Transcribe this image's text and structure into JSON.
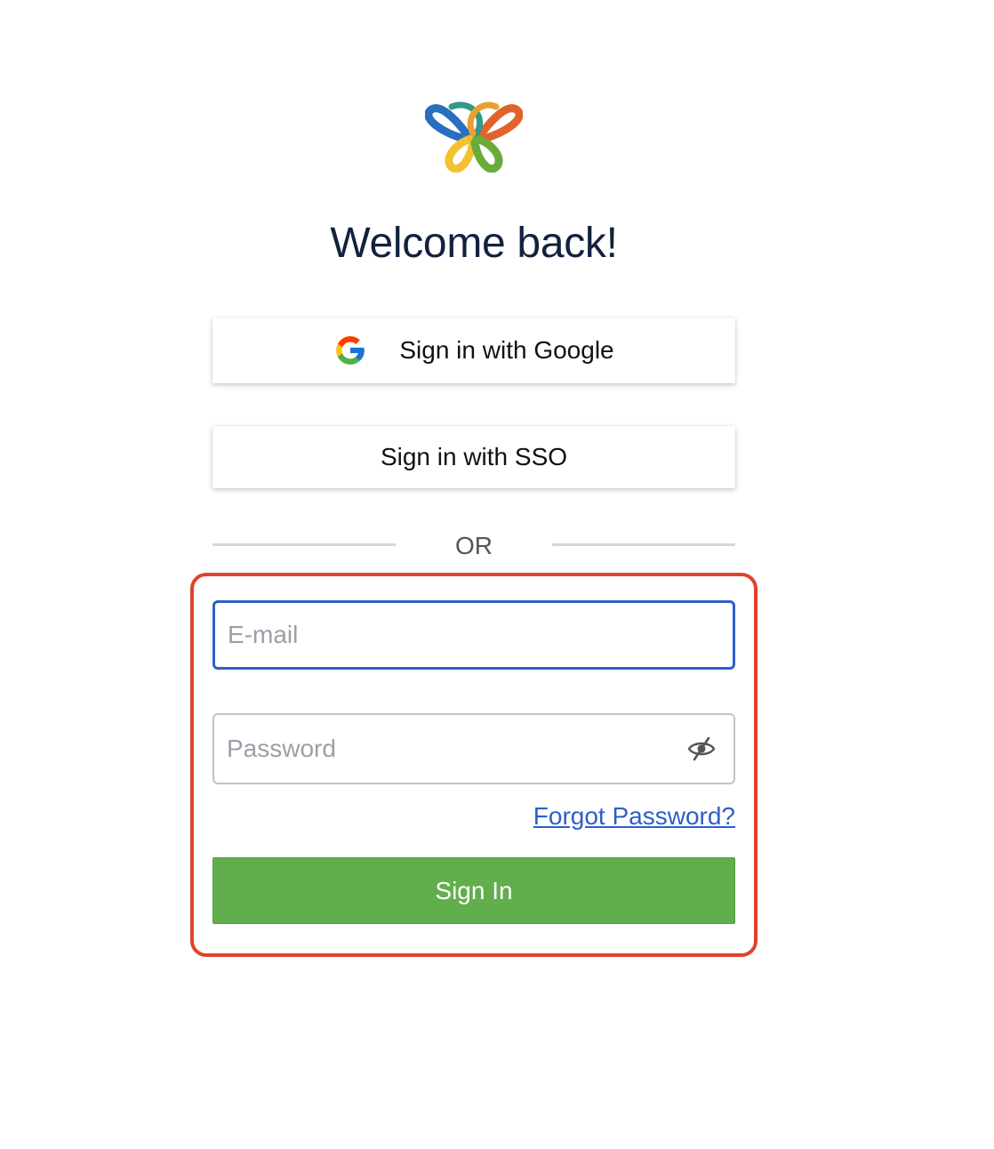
{
  "header": {
    "logo_icon": "butterfly-logo-icon",
    "title": "Welcome back!"
  },
  "oauth": {
    "google_label": "Sign in with Google",
    "google_icon": "google-g-icon",
    "sso_label": "Sign in with SSO"
  },
  "divider": {
    "text": "OR"
  },
  "form": {
    "email_placeholder": "E-mail",
    "email_value": "",
    "password_placeholder": "Password",
    "password_value": "",
    "password_toggle_icon": "eye-slash-icon",
    "forgot_label": "Forgot Password?",
    "submit_label": "Sign In"
  },
  "colors": {
    "title": "#13213f",
    "highlight_border": "#e0422e",
    "focus_border": "#2d5fc9",
    "link": "#2d5fc9",
    "submit_bg": "#62ae4c"
  }
}
